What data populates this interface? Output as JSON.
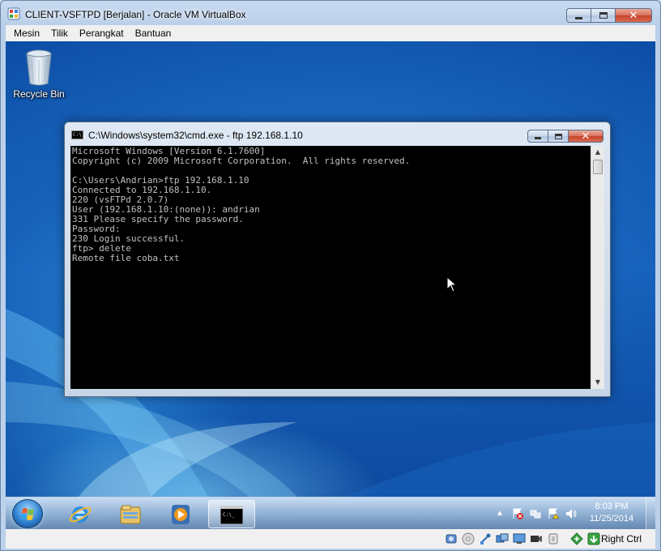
{
  "vbox": {
    "title": "CLIENT-VSFTPD [Berjalan] - Oracle VM VirtualBox",
    "menu": [
      "Mesin",
      "Tilik",
      "Perangkat",
      "Bantuan"
    ],
    "host_key": "Right Ctrl"
  },
  "desktop": {
    "icons": [
      {
        "label": "Recycle Bin",
        "icon": "recycle-bin-icon"
      }
    ]
  },
  "cmd": {
    "title": "C:\\Windows\\system32\\cmd.exe - ftp  192.168.1.10",
    "icon_text": "C:\\",
    "lines": [
      "Microsoft Windows [Version 6.1.7600]",
      "Copyright (c) 2009 Microsoft Corporation.  All rights reserved.",
      "",
      "C:\\Users\\Andrian>ftp 192.168.1.10",
      "Connected to 192.168.1.10.",
      "220 (vsFTPd 2.0.7)",
      "User (192.168.1.10:(none)): andrian",
      "331 Please specify the password.",
      "Password:",
      "230 Login successful.",
      "ftp> delete",
      "Remote file coba.txt"
    ]
  },
  "taskbar": {
    "pinned": [
      "internet-explorer-icon",
      "windows-explorer-icon",
      "media-player-icon",
      "command-prompt-icon"
    ],
    "active_item": "command-prompt-icon",
    "cmd_button_text": "C:\\_",
    "clock": {
      "time": "8:03 PM",
      "date": "11/25/2014"
    }
  }
}
